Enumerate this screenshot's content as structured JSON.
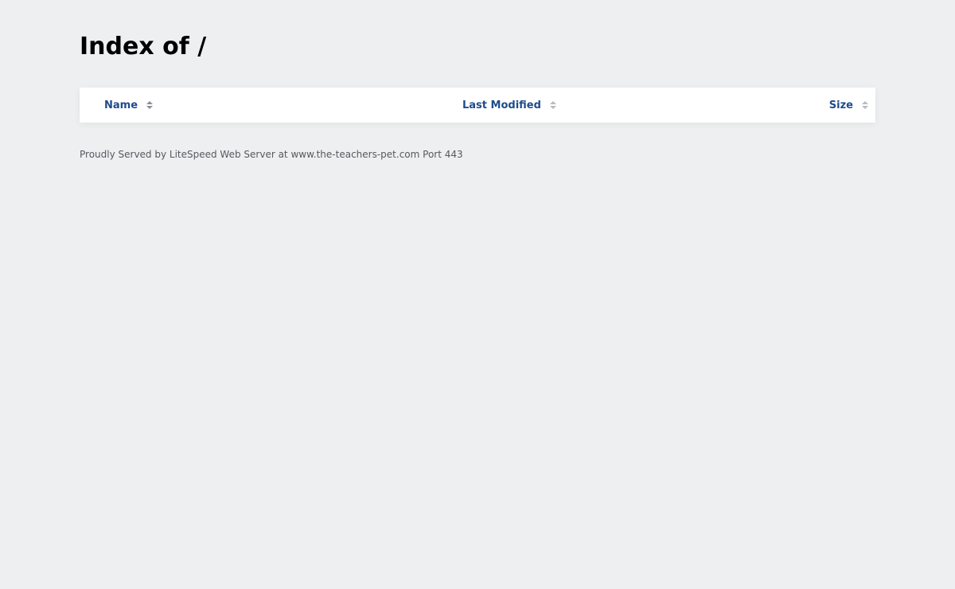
{
  "page": {
    "title": "Index of /"
  },
  "table": {
    "columns": [
      {
        "label": "Name",
        "sort_icon": "sort-icon"
      },
      {
        "label": "Last Modified",
        "sort_icon": "sort-icon"
      },
      {
        "label": "Size",
        "sort_icon": "sort-icon"
      }
    ],
    "rows": []
  },
  "footer": {
    "text": "Proudly Served by LiteSpeed Web Server at www.the-teachers-pet.com Port 443"
  },
  "colors": {
    "background": "#edeff1",
    "header_link": "#1e4b8c",
    "footer_text": "#555a60"
  }
}
